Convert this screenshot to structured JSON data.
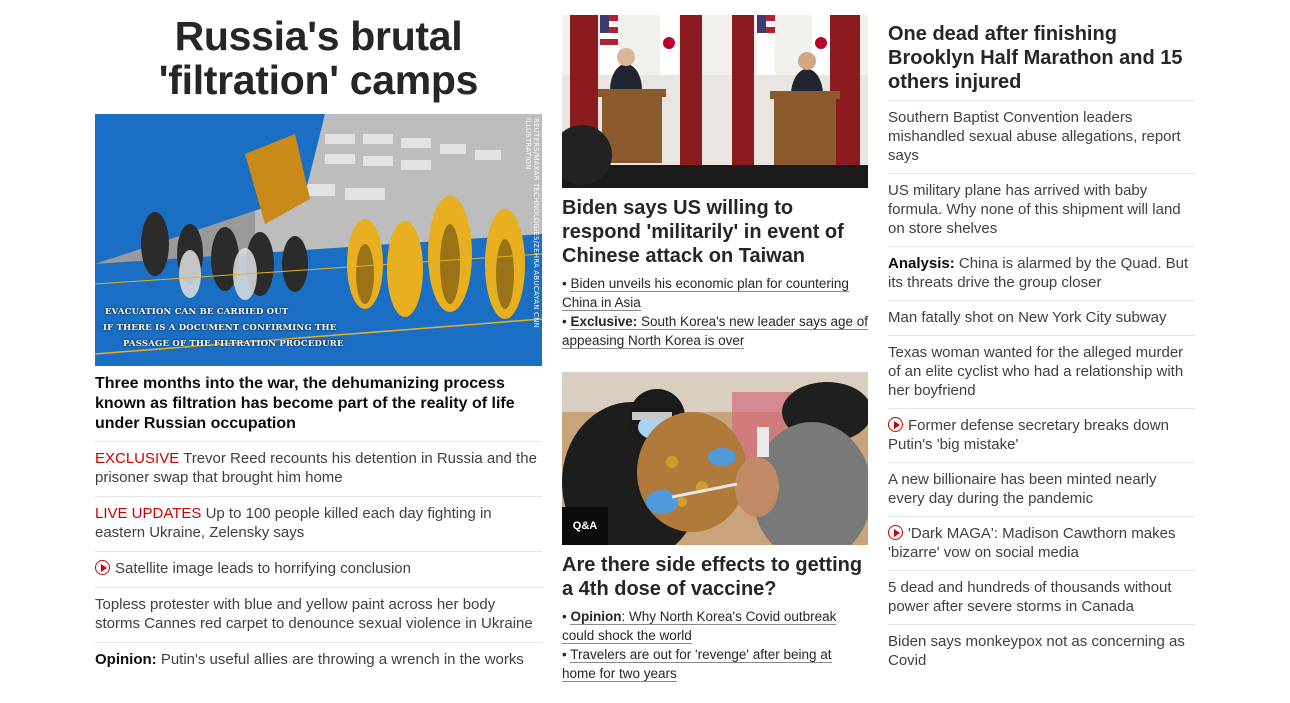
{
  "main": {
    "headline": "Russia's brutal 'filtration' camps",
    "image": {
      "credit": "REUTERS/MAXAR TECHNOLOGIES/ZEHRA ABUCAYAN CNN ILLUSTRATION",
      "overlay_lines": [
        "EVACUATION CAN BE CARRIED OUT",
        "IF THERE IS A DOCUMENT CONFIRMING THE",
        "PASSAGE OF THE FILTRATION PROCEDURE"
      ]
    },
    "subheadline": "Three months into the war, the dehumanizing process known as filtration has become part of the reality of life under Russian occupation",
    "stories": [
      {
        "kicker": "EXCLUSIVE",
        "text": " Trevor Reed recounts his detention in Russia and the prisoner swap that brought him home"
      },
      {
        "kicker": "LIVE UPDATES",
        "text": " Up to 100 people killed each day fighting in eastern Ukraine, Zelensky says"
      },
      {
        "video": true,
        "text": "Satellite image leads to horrifying conclusion"
      },
      {
        "text": "Topless protester with blue and yellow paint across her body storms Cannes red carpet to denounce sexual violence in Ukraine"
      },
      {
        "bold": "Opinion:",
        "text": " Putin's useful allies are throwing a wrench in the works"
      }
    ]
  },
  "center": {
    "story1": {
      "headline": "Biden says US willing to respond 'militarily' in event of Chinese attack on Taiwan",
      "bullets": [
        {
          "text": "Biden unveils his economic plan for countering China in Asia"
        },
        {
          "bold": "Exclusive:",
          "text": " South Korea's new leader says age of appeasing North Korea is over"
        }
      ]
    },
    "story2": {
      "badge": "Q&A",
      "headline": "Are there side effects to getting a 4th dose of vaccine?",
      "bullets": [
        {
          "bold": "Opinion",
          "text": ": Why North Korea's Covid outbreak could shock the world"
        },
        {
          "text": "Travelers are out for 'revenge' after being at home for two years"
        }
      ]
    }
  },
  "right": {
    "headline": "One dead after finishing Brooklyn Half Marathon and 15 others injured",
    "stories": [
      {
        "text": "Southern Baptist Convention leaders mishandled sexual abuse allegations, report says"
      },
      {
        "text": "US military plane has arrived with baby formula. Why none of this shipment will land on store shelves"
      },
      {
        "bold": "Analysis:",
        "text": " China is alarmed by the Quad. But its threats drive the group closer"
      },
      {
        "text": "Man fatally shot on New York City subway"
      },
      {
        "text": "Texas woman wanted for the alleged murder of an elite cyclist who had a relationship with her boyfriend"
      },
      {
        "video": true,
        "text": "Former defense secretary breaks down Putin's 'big mistake'"
      },
      {
        "text": "A new billionaire has been minted nearly every day during the pandemic"
      },
      {
        "video": true,
        "text": "'Dark MAGA': Madison Cawthorn makes 'bizarre' vow on social media"
      },
      {
        "text": "5 dead and hundreds of thousands without power after severe storms in Canada"
      },
      {
        "text": "Biden says monkeypox not as concerning as Covid"
      }
    ]
  },
  "colors": {
    "accent_red": "#cc0000",
    "text": "#0c0c0c",
    "muted": "#404040",
    "divider": "#e6e6e6",
    "overlay_blue": "#1a6fc4",
    "overlay_yellow": "#e8b020"
  }
}
